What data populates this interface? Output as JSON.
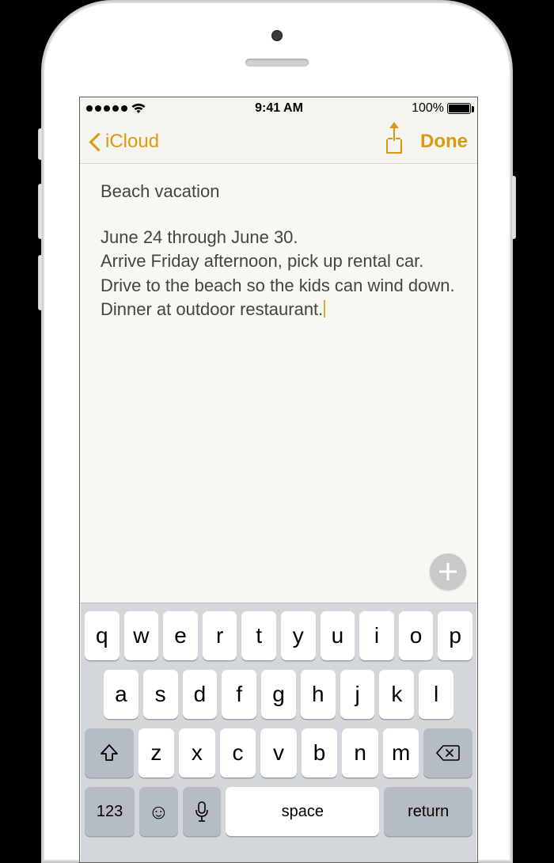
{
  "statusbar": {
    "time": "9:41 AM",
    "battery_pct": "100%"
  },
  "navbar": {
    "back_label": "iCloud",
    "done_label": "Done"
  },
  "note": {
    "title": "Beach vacation",
    "body": "June 24 through June 30.\nArrive Friday afternoon, pick up rental car. Drive to the beach so the kids can wind down. Dinner at outdoor restaurant."
  },
  "keyboard": {
    "row1": [
      "q",
      "w",
      "e",
      "r",
      "t",
      "y",
      "u",
      "i",
      "o",
      "p"
    ],
    "row2": [
      "a",
      "s",
      "d",
      "f",
      "g",
      "h",
      "j",
      "k",
      "l"
    ],
    "row3": [
      "z",
      "x",
      "c",
      "v",
      "b",
      "n",
      "m"
    ],
    "numkey_label": "123",
    "space_label": "space",
    "return_label": "return"
  },
  "colors": {
    "accent": "#d99a13",
    "note_bg": "#f9f7f1",
    "keyboard_bg": "#d3d6db"
  }
}
